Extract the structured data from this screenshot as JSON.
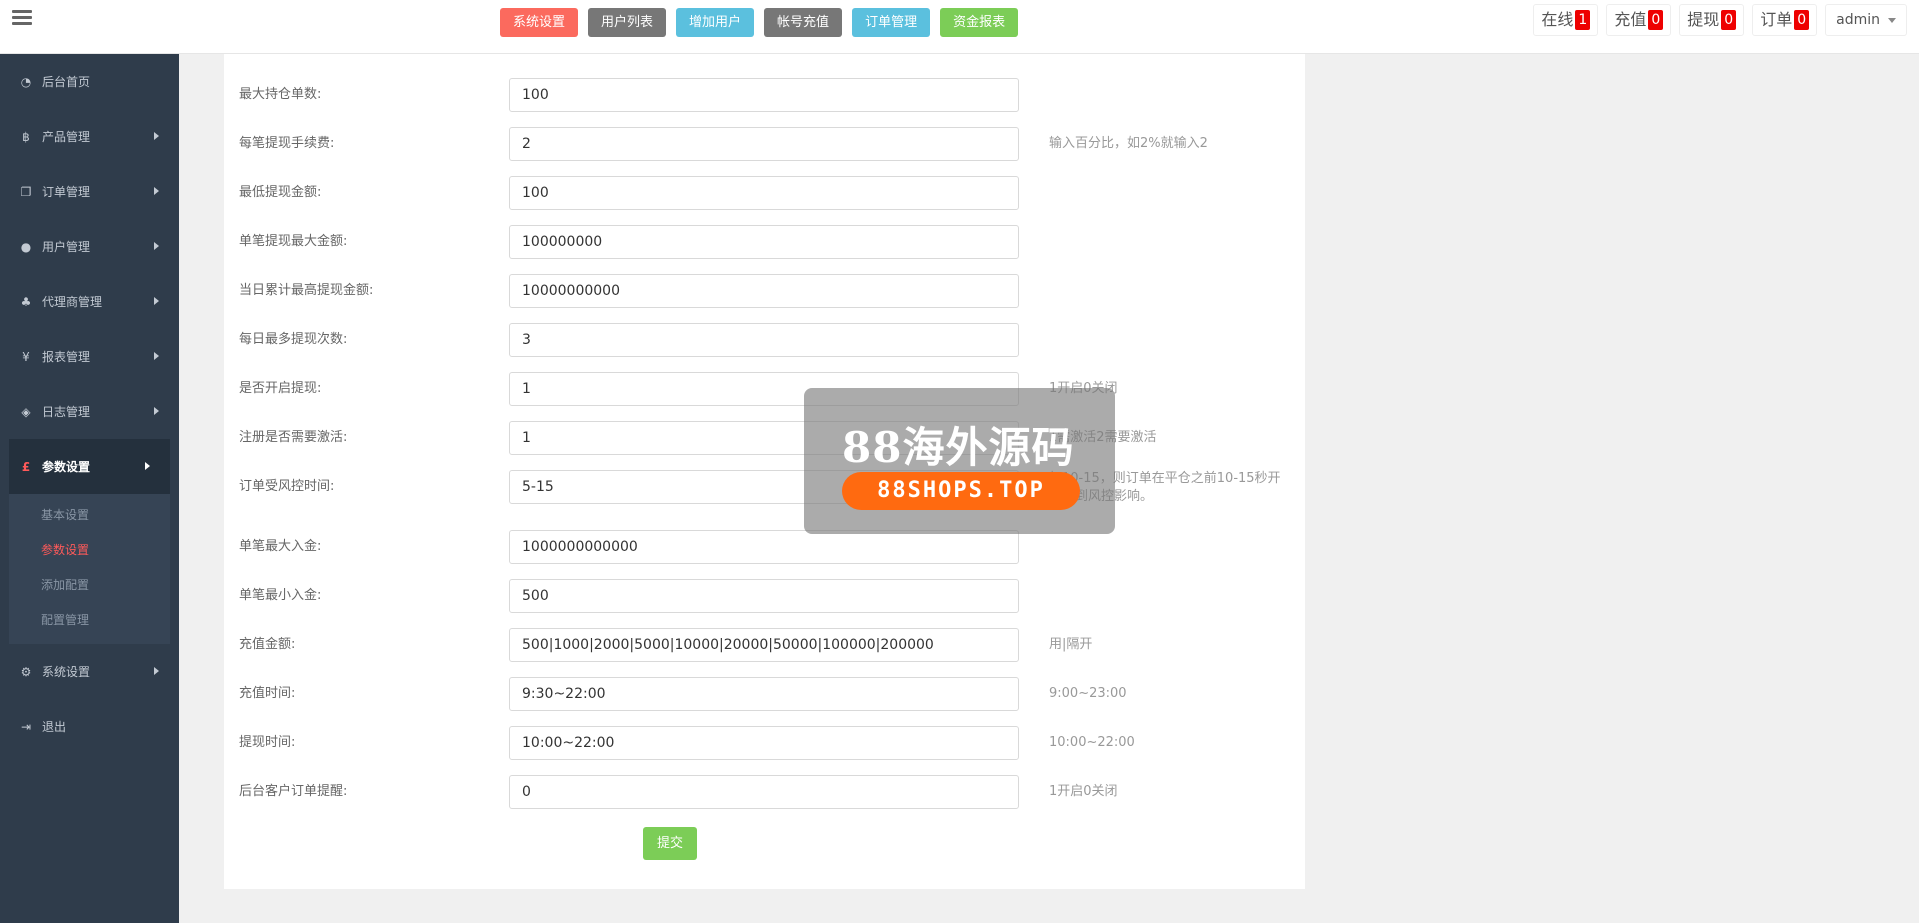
{
  "topnav": [
    {
      "label": "系统设置",
      "color": "#fb6a5e"
    },
    {
      "label": "用户列表",
      "color": "#777777"
    },
    {
      "label": "增加用户",
      "color": "#5bc0de"
    },
    {
      "label": "帐号充值",
      "color": "#777777"
    },
    {
      "label": "订单管理",
      "color": "#5bc0de"
    },
    {
      "label": "资金报表",
      "color": "#7ccd57"
    }
  ],
  "badges": [
    {
      "label": "在线",
      "count": "1"
    },
    {
      "label": "充值",
      "count": "0"
    },
    {
      "label": "提现",
      "count": "0"
    },
    {
      "label": "订单",
      "count": "0"
    }
  ],
  "user": {
    "name": "admin"
  },
  "sidebar": {
    "items": [
      {
        "label": "后台首页",
        "icon": "dashboard-icon"
      },
      {
        "label": "产品管理",
        "icon": "bitcoin-icon"
      },
      {
        "label": "订单管理",
        "icon": "copy-icon"
      },
      {
        "label": "用户管理",
        "icon": "user-icon"
      },
      {
        "label": "代理商管理",
        "icon": "sitemap-icon"
      },
      {
        "label": "报表管理",
        "icon": "yen-icon"
      },
      {
        "label": "日志管理",
        "icon": "tags-icon"
      }
    ],
    "active": {
      "label": "参数设置",
      "icon": "pound-icon",
      "glyph": "£"
    },
    "sub": [
      {
        "label": "基本设置"
      },
      {
        "label": "参数设置"
      },
      {
        "label": "添加配置"
      },
      {
        "label": "配置管理"
      }
    ],
    "bottom": [
      {
        "label": "系统设置",
        "icon": "gears-icon"
      },
      {
        "label": "退出",
        "icon": "sign-out-icon"
      }
    ]
  },
  "form": {
    "rows": [
      {
        "label": "最大持仓单数:",
        "value": "100",
        "hint": ""
      },
      {
        "label": "每笔提现手续费:",
        "value": "2",
        "hint": "输入百分比，如2%就输入2"
      },
      {
        "label": "最低提现金额:",
        "value": "100",
        "hint": ""
      },
      {
        "label": "单笔提现最大金额:",
        "value": "100000000",
        "hint": ""
      },
      {
        "label": "当日累计最高提现金额:",
        "value": "10000000000",
        "hint": ""
      },
      {
        "label": "每日最多提现次数:",
        "value": "3",
        "hint": ""
      },
      {
        "label": "是否开启提现:",
        "value": "1",
        "hint": "1开启0关闭"
      },
      {
        "label": "注册是否需要激活:",
        "value": "1",
        "hint": "1需激活2需要激活"
      },
      {
        "label": "订单受风控时间:",
        "value": "5-15",
        "hint": "如10-15，则订单在平仓之前10-15秒开始受到风控影响。"
      },
      {
        "label": "单笔最大入金:",
        "value": "1000000000000",
        "hint": ""
      },
      {
        "label": "单笔最小入金:",
        "value": "500",
        "hint": ""
      },
      {
        "label": "充值金额:",
        "value": "500|1000|2000|5000|10000|20000|50000|100000|200000",
        "hint": "用|隔开"
      },
      {
        "label": "充值时间:",
        "value": "9:30~22:00",
        "hint": "9:00~23:00"
      },
      {
        "label": "提现时间:",
        "value": "10:00~22:00",
        "hint": "10:00~22:00"
      },
      {
        "label": "后台客户订单提醒:",
        "value": "0",
        "hint": "1开启0关闭"
      }
    ],
    "submit_label": "提交"
  },
  "watermark": {
    "title": "88海外源码",
    "subtitle": "88SHOPS.TOP"
  }
}
